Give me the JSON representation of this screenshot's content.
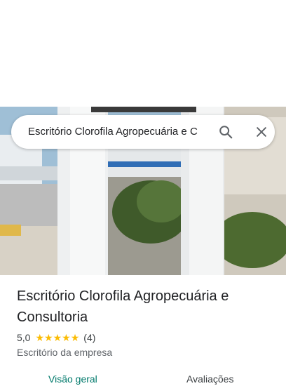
{
  "search": {
    "query": "Escritório Clorofila Agropecuária e C"
  },
  "place": {
    "name": "Escritório Clorofila Agropecuária e Consultoria",
    "rating": "5,0",
    "stars": [
      "★",
      "★",
      "★",
      "★",
      "★"
    ],
    "review_count": "(4)",
    "category": "Escritório da empresa"
  },
  "tabs": [
    {
      "label": "Visão geral"
    },
    {
      "label": "Avaliações"
    }
  ],
  "colors": {
    "accent": "#00796b",
    "star": "#fbbc04"
  },
  "icons": {
    "search": "search-icon",
    "close": "close-icon"
  }
}
